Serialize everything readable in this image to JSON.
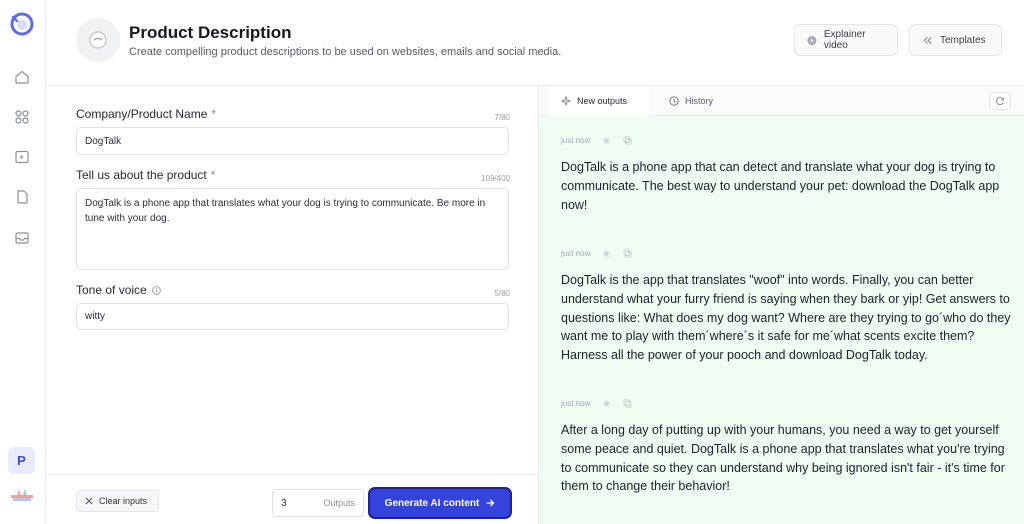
{
  "header": {
    "title": "Product Description",
    "subtitle": "Create compelling product descriptions to be used on websites, emails and social media.",
    "explainer_label": "Explainer video",
    "templates_label": "Templates"
  },
  "sidebar": {
    "avatar_letter": "P",
    "icons": [
      "home-icon",
      "apps-icon",
      "play-icon",
      "document-icon",
      "inbox-icon"
    ]
  },
  "form": {
    "company": {
      "label": "Company/Product Name",
      "required_mark": "*",
      "counter": "7/80",
      "value": "DogTalk"
    },
    "about": {
      "label": "Tell us about the product",
      "required_mark": "*",
      "counter": "109/400",
      "value": "DogTalk is a phone app that translates what your dog is trying to communicate. Be more in tune with your dog."
    },
    "tone": {
      "label": "Tone of voice",
      "counter": "5/80",
      "value": "witty"
    }
  },
  "footer": {
    "clear_label": "Clear inputs",
    "outputs_value": "3",
    "outputs_label": "Outputs",
    "generate_label": "Generate AI content"
  },
  "panel": {
    "tabs": [
      {
        "label": "New outputs"
      },
      {
        "label": "History"
      }
    ],
    "outputs": [
      {
        "time": "just now",
        "text": "DogTalk is a phone app that can detect and translate what your dog is trying to communicate. The best way to understand your pet: download the DogTalk app now!"
      },
      {
        "time": "just now",
        "text": "DogTalk is the app that translates \"woof\" into words. Finally, you can better understand what your furry friend is saying when they bark or yip! Get answers to questions like: What does my dog want? Where are they trying to go´who do they want me to play with them´where´s it safe for me´what scents excite them? Harness all the power of your pooch and download DogTalk today."
      },
      {
        "time": "just now",
        "text": "After a long day of putting up with your humans, you need a way to get yourself some peace and quiet. DogTalk is a phone app that translates what you're trying to communicate so they can understand why being ignored isn't fair - it's time for them to change their behavior!"
      }
    ]
  },
  "colors": {
    "accent": "#3543dd",
    "output_bg": "#f0fdf2"
  }
}
